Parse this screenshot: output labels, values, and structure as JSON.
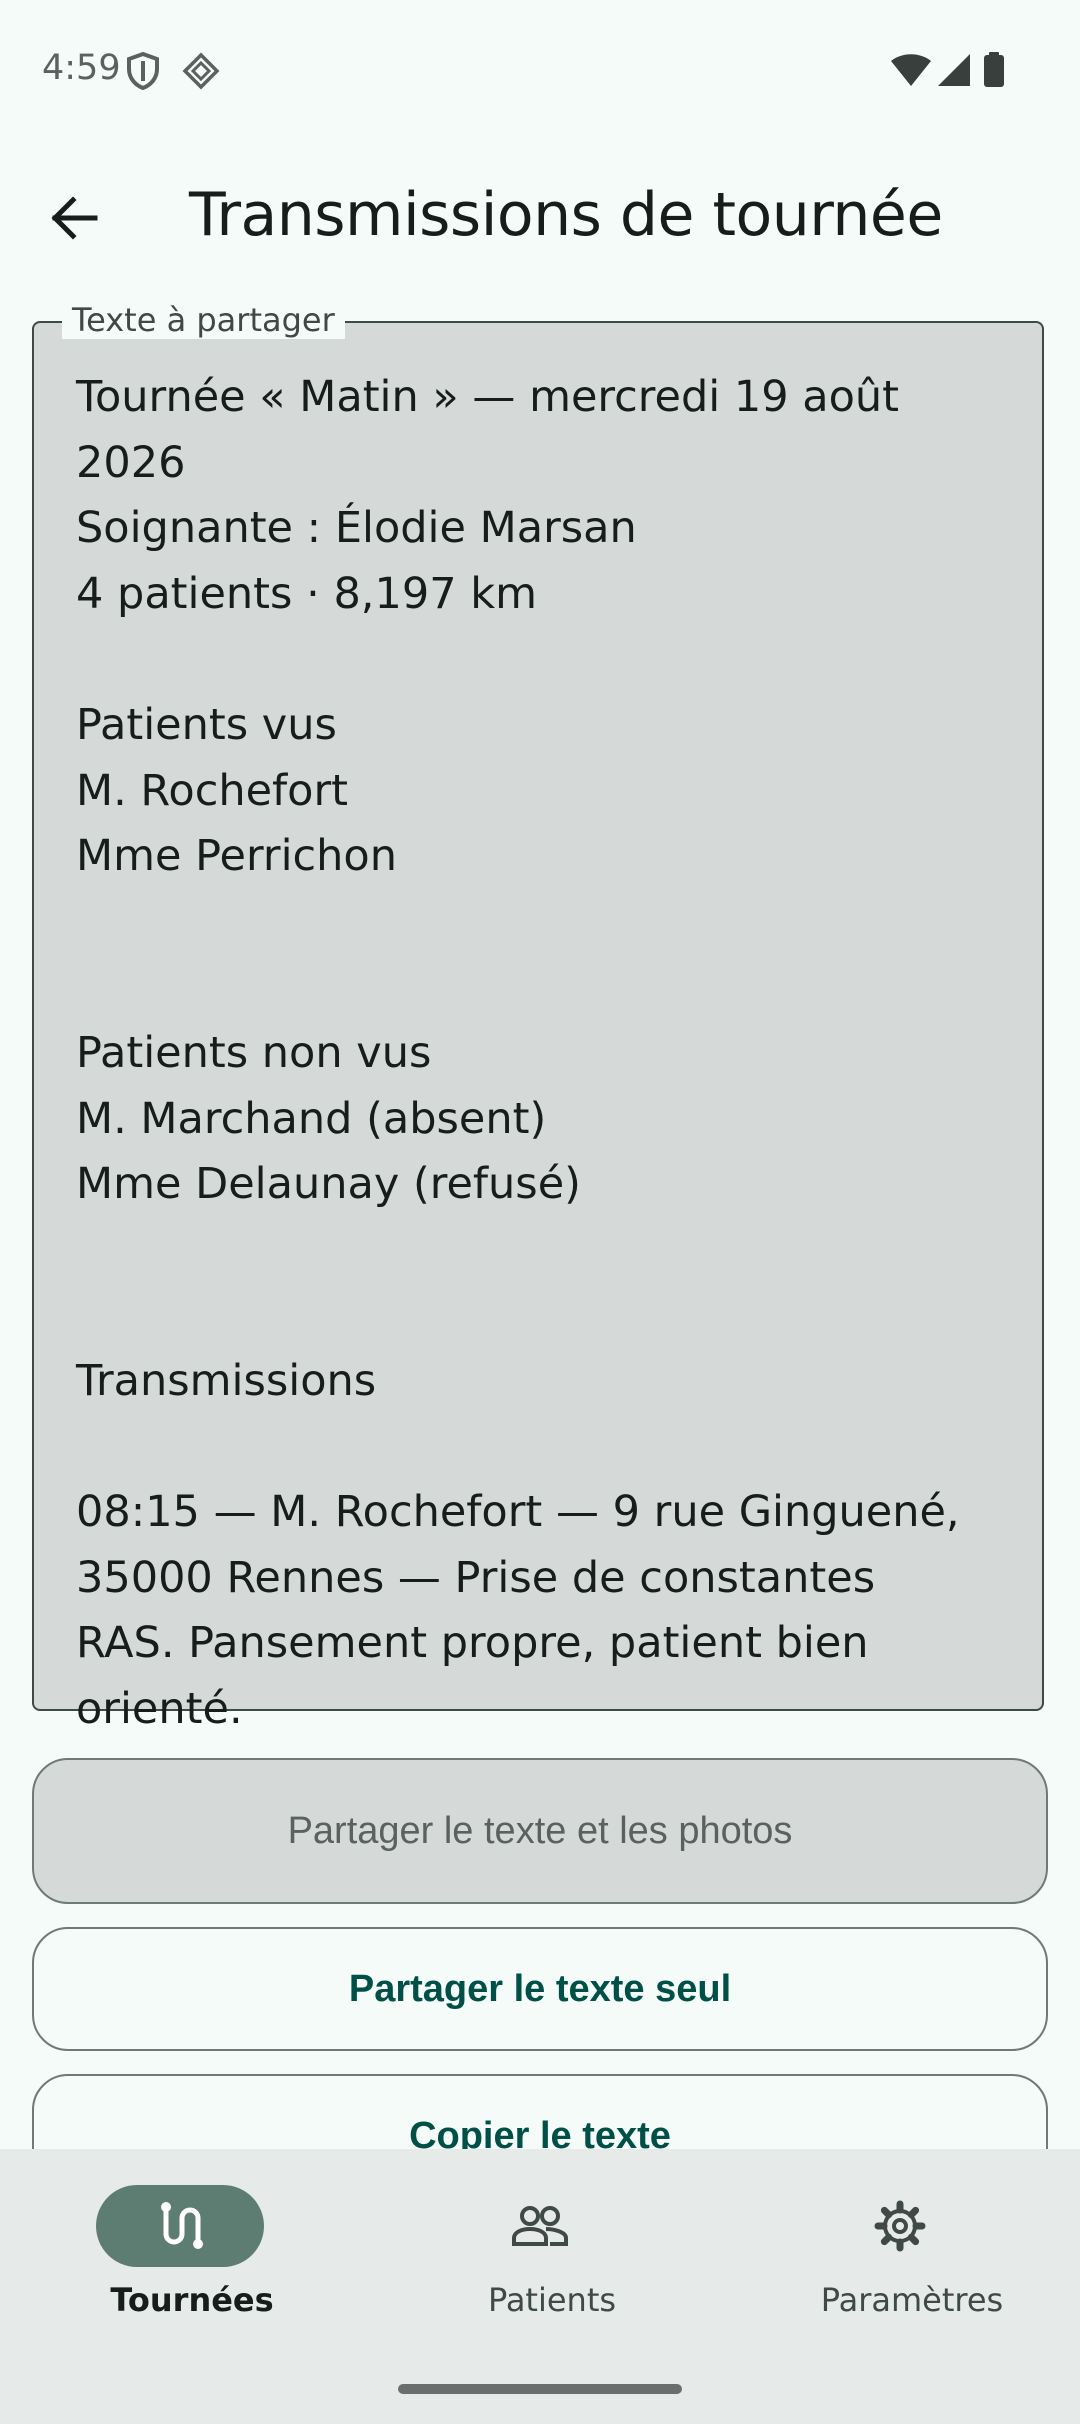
{
  "status": {
    "time": "4:59"
  },
  "header": {
    "title": "Transmissions de tournée"
  },
  "share_field": {
    "label": "Texte à partager",
    "text": "Tournée « Matin » — mercredi 19 août 2026\nSoignante : Élodie Marsan\n4 patients · 8,197 km\n\nPatients vus\nM. Rochefort\nMme Perrichon\n\n\nPatients non vus\nM. Marchand (absent)\nMme Delaunay (refusé)\n\n\nTransmissions\n\n08:15 — M. Rochefort — 9 rue Ginguené,\n35000 Rennes — Prise de constantes\nRAS. Pansement propre, patient bien\norienté."
  },
  "actions": {
    "share_text_photos": "Partager le texte et les photos",
    "share_text_only": "Partager le texte seul",
    "copy_text": "Copier le texte"
  },
  "nav": {
    "items": [
      {
        "label": "Tournées",
        "icon": "route-icon",
        "active": true
      },
      {
        "label": "Patients",
        "icon": "people-icon",
        "active": false
      },
      {
        "label": "Paramètres",
        "icon": "gear-icon",
        "active": false
      }
    ]
  },
  "colors": {
    "accent": "#005047",
    "nav_active": "#5e7d72",
    "background": "#f4fbf8"
  }
}
